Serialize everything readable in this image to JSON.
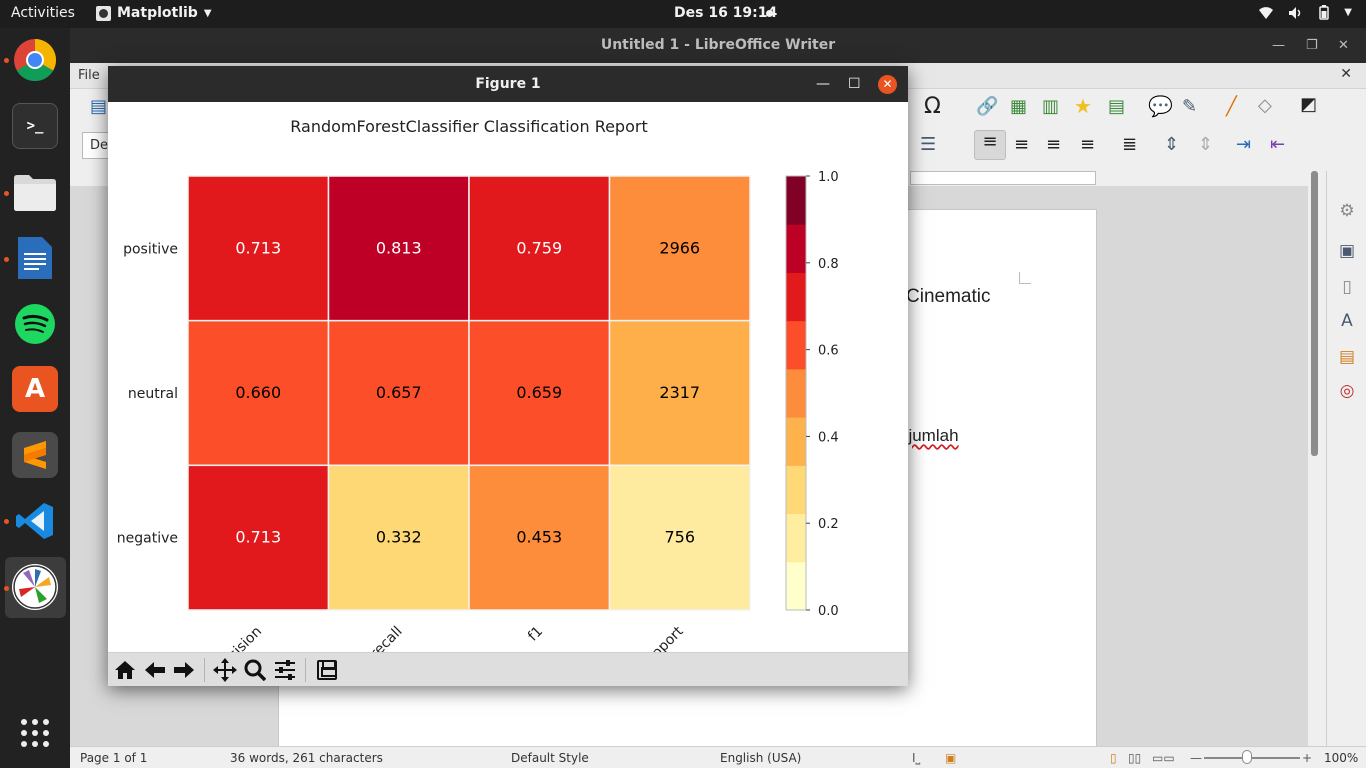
{
  "topbar": {
    "activities": "Activities",
    "app_name": "Matplotlib",
    "clock": "Des 16  19:14"
  },
  "dock": {
    "items": [
      "Google Chrome",
      "Terminal",
      "Files",
      "LibreOffice Writer",
      "Spotify",
      "Ubuntu Software",
      "Sublime Text",
      "Visual Studio Code",
      "Matplotlib",
      "Show Applications"
    ]
  },
  "writer": {
    "title": "Untitled 1 - LibreOffice Writer",
    "menu_file": "File",
    "style_box": "De",
    "doc_text_1": "Cinematic",
    "doc_text_2": "ejumlah",
    "status": {
      "page": "Page 1 of 1",
      "words": "36 words, 261 characters",
      "style": "Default Style",
      "language": "English (USA)",
      "zoom": "100%"
    }
  },
  "figure": {
    "window_title": "Figure 1"
  },
  "chart_data": {
    "type": "heatmap",
    "title": "RandomForestClassifier Classification Report",
    "rows": [
      "positive",
      "neutral",
      "negative"
    ],
    "columns": [
      "precision",
      "recall",
      "f1",
      "support"
    ],
    "values": [
      [
        "0.713",
        "0.813",
        "0.759",
        "2966"
      ],
      [
        "0.660",
        "0.657",
        "0.659",
        "2317"
      ],
      [
        "0.713",
        "0.332",
        "0.453",
        "756"
      ]
    ],
    "cell_colors": [
      [
        "#e1191d",
        "#bf0026",
        "#e1191d",
        "#fd8c3b"
      ],
      [
        "#fc4e29",
        "#fc4e29",
        "#fc4e29",
        "#feaf4a"
      ],
      [
        "#e1191d",
        "#fed875",
        "#fd8c3b",
        "#ffeba0"
      ]
    ],
    "text_colors": [
      [
        "#ffffff",
        "#ffffff",
        "#ffffff",
        "#000000"
      ],
      [
        "#000000",
        "#000000",
        "#000000",
        "#000000"
      ],
      [
        "#ffffff",
        "#000000",
        "#000000",
        "#000000"
      ]
    ],
    "colorbar": {
      "ticks": [
        "1.0",
        "0.8",
        "0.6",
        "0.4",
        "0.2",
        "0.0"
      ],
      "range": [
        0,
        1
      ],
      "colors": [
        "#ffffcc",
        "#ffeda0",
        "#fed976",
        "#feb24c",
        "#fd8d3c",
        "#fc4e2a",
        "#e31a1c",
        "#bd0026",
        "#800026"
      ]
    }
  }
}
